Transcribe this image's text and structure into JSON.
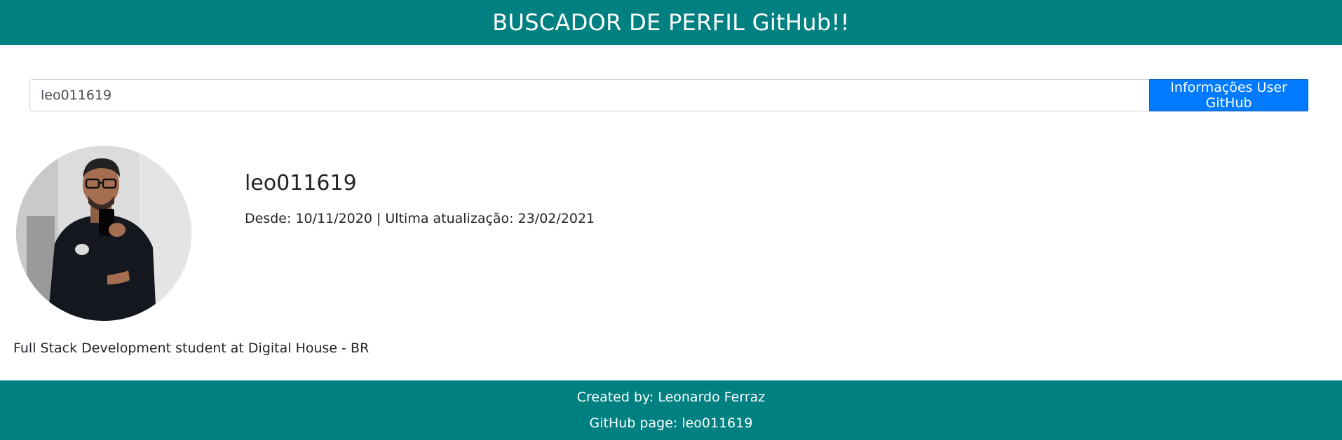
{
  "header": {
    "title": "BUSCADOR DE PERFIL GitHub!!"
  },
  "search": {
    "value": "leo011619",
    "button_label": "Informações User GitHub"
  },
  "profile": {
    "username": "leo011619",
    "dates": "Desde: 10/11/2020 | Ultima atualização: 23/02/2021",
    "bio": "Full Stack Development student at Digital House - BR",
    "avatar_icon": "profile-photo"
  },
  "footer": {
    "created_by": "Created by: Leonardo Ferraz",
    "github_page": "GitHub page: leo011619"
  },
  "colors": {
    "header_bg": "#008080",
    "button_bg": "#007bff",
    "footer_bg": "#008080"
  }
}
